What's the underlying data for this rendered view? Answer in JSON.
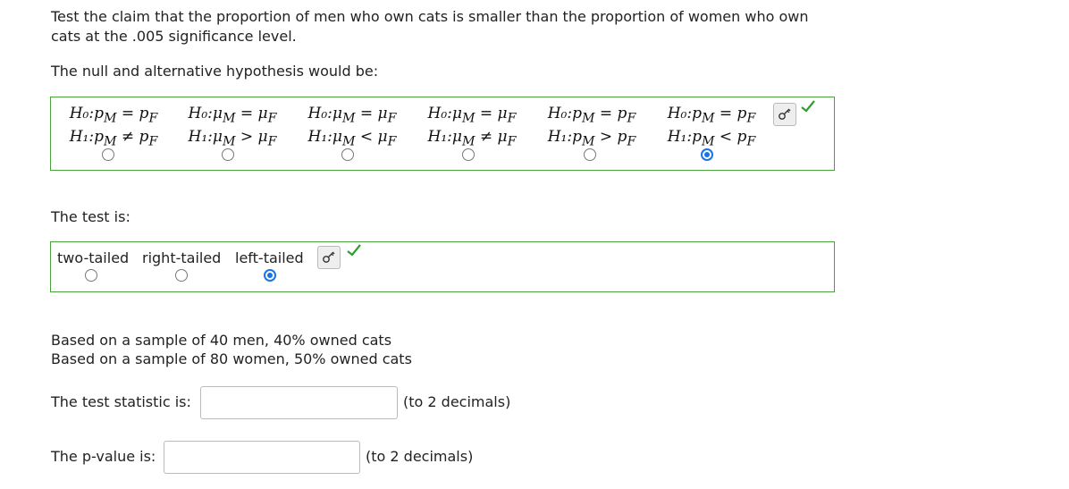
{
  "question": {
    "text": "Test the claim that the proportion of men who own cats is smaller than the proportion of women who own cats at the .005 significance level."
  },
  "hypothesis": {
    "prompt": "The null and alternative hypothesis would be:",
    "options": [
      {
        "h0_lhs": "H₀:",
        "h0": "p",
        "h0_sub1": "M",
        "h0_rel": " = ",
        "h0_v2": "p",
        "h0_sub2": "F",
        "h1_lhs": "H₁:",
        "h1": "p",
        "h1_sub1": "M",
        "h1_rel": " ≠ ",
        "h1_v2": "p",
        "h1_sub2": "F"
      },
      {
        "h0_lhs": "H₀:",
        "h0": "μ",
        "h0_sub1": "M",
        "h0_rel": " = ",
        "h0_v2": "μ",
        "h0_sub2": "F",
        "h1_lhs": "H₁:",
        "h1": "μ",
        "h1_sub1": "M",
        "h1_rel": " > ",
        "h1_v2": "μ",
        "h1_sub2": "F"
      },
      {
        "h0_lhs": "H₀:",
        "h0": "μ",
        "h0_sub1": "M",
        "h0_rel": " = ",
        "h0_v2": "μ",
        "h0_sub2": "F",
        "h1_lhs": "H₁:",
        "h1": "μ",
        "h1_sub1": "M",
        "h1_rel": " < ",
        "h1_v2": "μ",
        "h1_sub2": "F"
      },
      {
        "h0_lhs": "H₀:",
        "h0": "μ",
        "h0_sub1": "M",
        "h0_rel": " = ",
        "h0_v2": "μ",
        "h0_sub2": "F",
        "h1_lhs": "H₁:",
        "h1": "μ",
        "h1_sub1": "M",
        "h1_rel": " ≠ ",
        "h1_v2": "μ",
        "h1_sub2": "F"
      },
      {
        "h0_lhs": "H₀:",
        "h0": "p",
        "h0_sub1": "M",
        "h0_rel": " = ",
        "h0_v2": "p",
        "h0_sub2": "F",
        "h1_lhs": "H₁:",
        "h1": "p",
        "h1_sub1": "M",
        "h1_rel": " > ",
        "h1_v2": "p",
        "h1_sub2": "F"
      },
      {
        "h0_lhs": "H₀:",
        "h0": "p",
        "h0_sub1": "M",
        "h0_rel": " = ",
        "h0_v2": "p",
        "h0_sub2": "F",
        "h1_lhs": "H₁:",
        "h1": "p",
        "h1_sub1": "M",
        "h1_rel": " < ",
        "h1_v2": "p",
        "h1_sub2": "F"
      }
    ],
    "selected_index": 5
  },
  "test_type": {
    "prompt": "The test is:",
    "options": [
      "two-tailed",
      "right-tailed",
      "left-tailed"
    ],
    "selected_index": 2
  },
  "samples": {
    "line1": "Based on a sample of 40 men, 40% owned cats",
    "line2": "Based on a sample of 80 women, 50% owned cats"
  },
  "test_statistic": {
    "label": "The test statistic is:",
    "value": "",
    "hint": "(to 2 decimals)"
  },
  "p_value": {
    "label": "The p-value is:",
    "value": "",
    "hint": "(to 2 decimals)"
  },
  "colors": {
    "correct_check": "#2e9e2e",
    "box_border": "#4aa33a",
    "radio_selected": "#1a73e8"
  },
  "icons": {
    "key": "key-icon",
    "check": "checkmark-icon"
  }
}
